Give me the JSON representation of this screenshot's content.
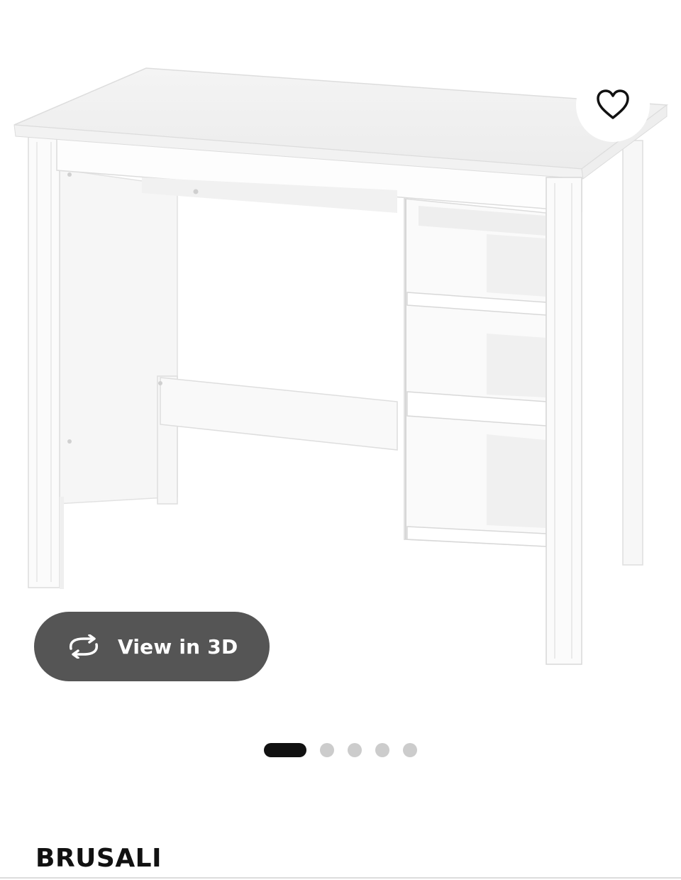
{
  "product": {
    "name": "BRUSALI",
    "image_alt": "White desk with three open shelves"
  },
  "favorite": {
    "icon": "heart-outline-icon"
  },
  "view3d": {
    "label": "View in 3D",
    "icon": "rotate-arrows-icon"
  },
  "carousel": {
    "total": 5,
    "active_index": 0
  },
  "colors": {
    "button_bg": "#555555",
    "dot_active": "#111111",
    "dot_inactive": "#cccccc",
    "text": "#111111"
  }
}
